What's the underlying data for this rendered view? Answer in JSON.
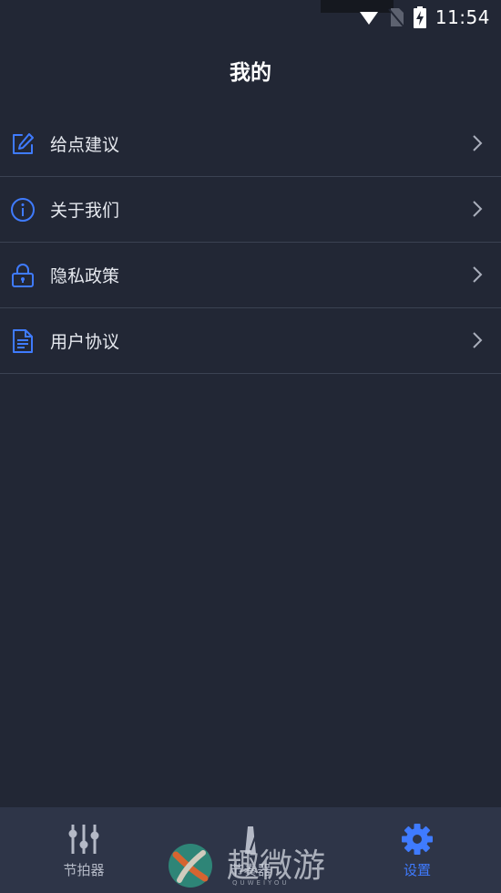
{
  "status": {
    "time": "11:54"
  },
  "header": {
    "title": "我的"
  },
  "menu": [
    {
      "label": "给点建议",
      "icon": "edit-icon"
    },
    {
      "label": "关于我们",
      "icon": "info-icon"
    },
    {
      "label": "隐私政策",
      "icon": "lock-icon"
    },
    {
      "label": "用户协议",
      "icon": "document-icon"
    }
  ],
  "tabbar": {
    "tabs": [
      {
        "label": "节拍器",
        "icon": "sliders-icon",
        "active": false
      },
      {
        "label": "节奏器",
        "icon": "metronome-icon",
        "active": false
      },
      {
        "label": "设置",
        "icon": "gear-icon",
        "active": true
      }
    ]
  },
  "watermark": {
    "text": "趣微游",
    "sub": "QUWEIYOU"
  },
  "colors": {
    "background": "#222735",
    "accent": "#3f7bff",
    "tabbar": "#2e3548",
    "divider": "#3b4252"
  }
}
